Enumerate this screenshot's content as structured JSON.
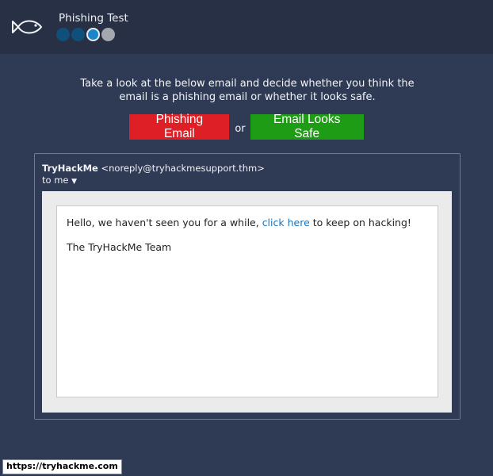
{
  "app": {
    "title": "Phishing Test",
    "icon": "fish-icon",
    "progress": {
      "total": 4,
      "current": 3
    }
  },
  "instruction": "Take a look at the below email and decide whether you think the email is a phishing email or whether it looks safe.",
  "actions": {
    "phishing_label": "Phishing Email",
    "or_label": "or",
    "safe_label": "Email Looks Safe"
  },
  "email": {
    "sender_name": "TryHackMe",
    "sender_address": "<noreply@tryhackmesupport.thm>",
    "to_label": "to me",
    "to_toggle_icon": "caret-down-icon",
    "body_before_link": "Hello, we haven't seen you for a while, ",
    "link_text": "click here",
    "body_after_link": " to keep on hacking!",
    "signature": "The TryHackMe Team"
  },
  "status_bar": {
    "url": "https://tryhackme.com"
  },
  "colors": {
    "background": "#2f3a55",
    "topbar": "#283046",
    "phishing_button": "#de2026",
    "safe_button": "#1f9c16",
    "link": "#1a73b8"
  }
}
